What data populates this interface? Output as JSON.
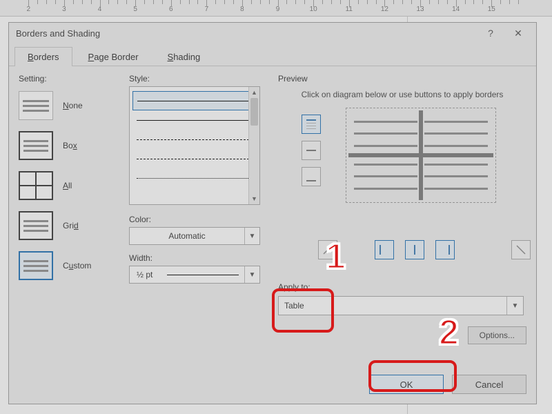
{
  "ruler": {
    "units": [
      2,
      3,
      4,
      5,
      6,
      7,
      8,
      9,
      10,
      11,
      12,
      13,
      14,
      15
    ]
  },
  "dialog": {
    "title": "Borders and Shading",
    "help_icon": "?",
    "close_icon": "✕",
    "tabs": [
      {
        "label": "Borders",
        "key": "B",
        "active": true
      },
      {
        "label": "Page Border",
        "key": "P",
        "active": false
      },
      {
        "label": "Shading",
        "key": "S",
        "active": false
      }
    ],
    "setting": {
      "header": "Setting:",
      "items": [
        {
          "label": "None",
          "key": "N",
          "type": "none",
          "selected": false
        },
        {
          "label": "Box",
          "key": "x",
          "type": "box",
          "selected": false
        },
        {
          "label": "All",
          "key": "A",
          "type": "all",
          "selected": false
        },
        {
          "label": "Grid",
          "key": "d",
          "type": "grid",
          "selected": false
        },
        {
          "label": "Custom",
          "key": "u",
          "type": "custom",
          "selected": true
        }
      ]
    },
    "style": {
      "label": "Style:",
      "styles": [
        "solid",
        "solid",
        "dashed",
        "dashed",
        "dotted-dash"
      ]
    },
    "color": {
      "label": "Color:",
      "value": "Automatic"
    },
    "width": {
      "label": "Width:",
      "value": "½ pt"
    },
    "preview": {
      "header": "Preview",
      "hint": "Click on diagram below or use buttons to apply borders",
      "side_buttons": [
        "top-border",
        "mid-h-border",
        "bottom-border"
      ],
      "bottom_buttons": [
        "diag1",
        "left-border",
        "mid-v-border",
        "right-border",
        "diag2"
      ]
    },
    "apply_to": {
      "label": "Apply to:",
      "value": "Table"
    },
    "options_label": "Options...",
    "ok_label": "OK",
    "cancel_label": "Cancel"
  },
  "annotations": {
    "badge1": "1",
    "badge2": "2"
  }
}
